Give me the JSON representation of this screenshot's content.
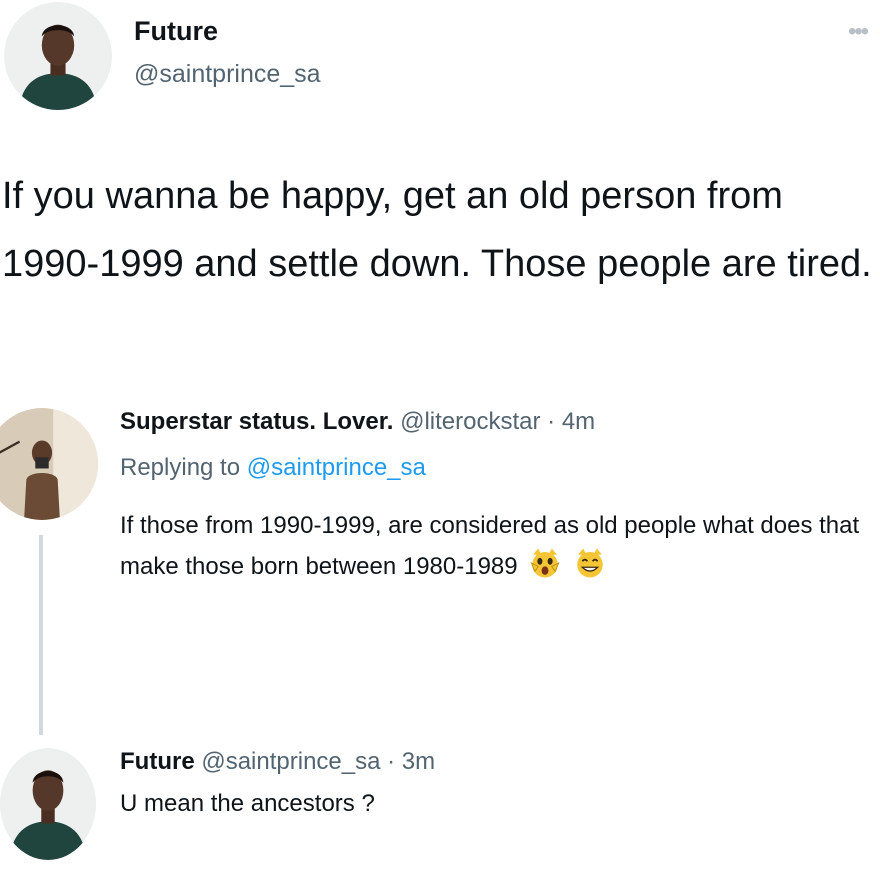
{
  "main_tweet": {
    "author_name": "Future",
    "author_handle": "@saintprince_sa",
    "more_icon": "ellipsis-icon",
    "text": "If you wanna be happy, get an old person from 1990-1999 and settle down. Those people are tired."
  },
  "reply": {
    "author_name": "Superstar status. Lover.",
    "meta": "@literockstar · 4m",
    "replying_label": "Replying to",
    "replying_mention": "@saintprince_sa",
    "text": "If those from 1990-1999, are considered as old people what does that make those born between 1980-1989",
    "emojis": [
      "screaming-cat-emoji",
      "grinning-cat-emoji"
    ]
  },
  "reply2": {
    "author_name": "Future",
    "meta": "@saintprince_sa · 3m",
    "text": "U mean the ancestors ?"
  },
  "colors": {
    "text": "#0f1419",
    "secondary": "#536471",
    "link": "#1d9bf0",
    "thread_line": "#cfd9de"
  }
}
